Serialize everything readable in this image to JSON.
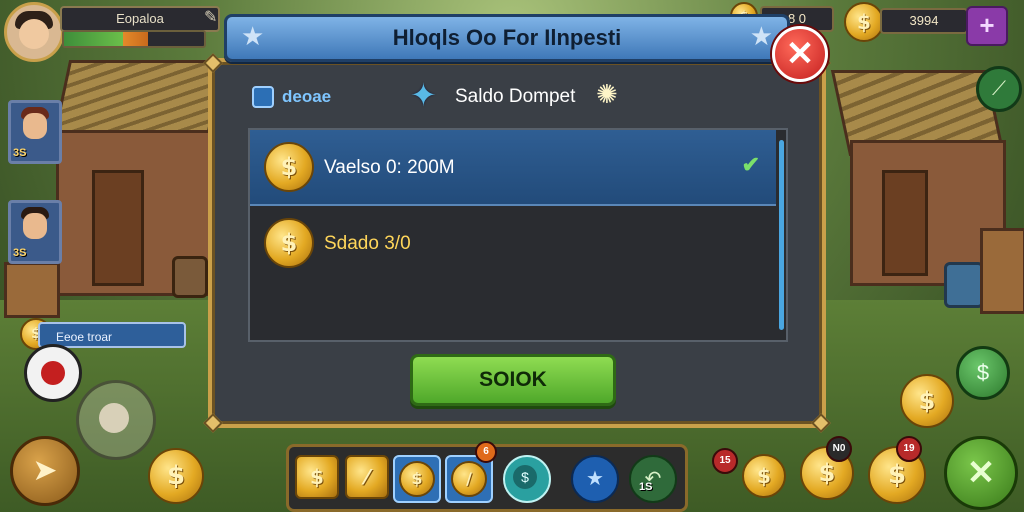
{
  "hud": {
    "player_name": "Eopaloa",
    "xp_fraction": 0.6,
    "top_value": "8 0",
    "currency_amount": "3994",
    "plus_label": "+",
    "portraits": [
      {
        "value": "3S"
      },
      {
        "value": "3S"
      }
    ],
    "location_tag": "Eeoe troar",
    "badges": {
      "slot_badge": "6",
      "counter_left": "15",
      "counter_mid": "N0",
      "counter_right": "19"
    }
  },
  "dialog": {
    "title": "Hloqls Oo For Ilnpesti",
    "close_icon": "close-x",
    "tab_label": "deoae",
    "wallet_title": "Saldo Dompet",
    "items": [
      {
        "label": "Vaelso 0: 200M",
        "selected": true
      },
      {
        "label": "Sdado 3/0",
        "selected": false
      }
    ],
    "ok_label": "SOIOK"
  },
  "bottom_bar": {
    "slot_badge_text": "1S"
  },
  "colors": {
    "title_blue": "#3f78b8",
    "frame_gold": "#caa04a",
    "ok_green": "#4fa82a",
    "close_red": "#c41f1f"
  }
}
